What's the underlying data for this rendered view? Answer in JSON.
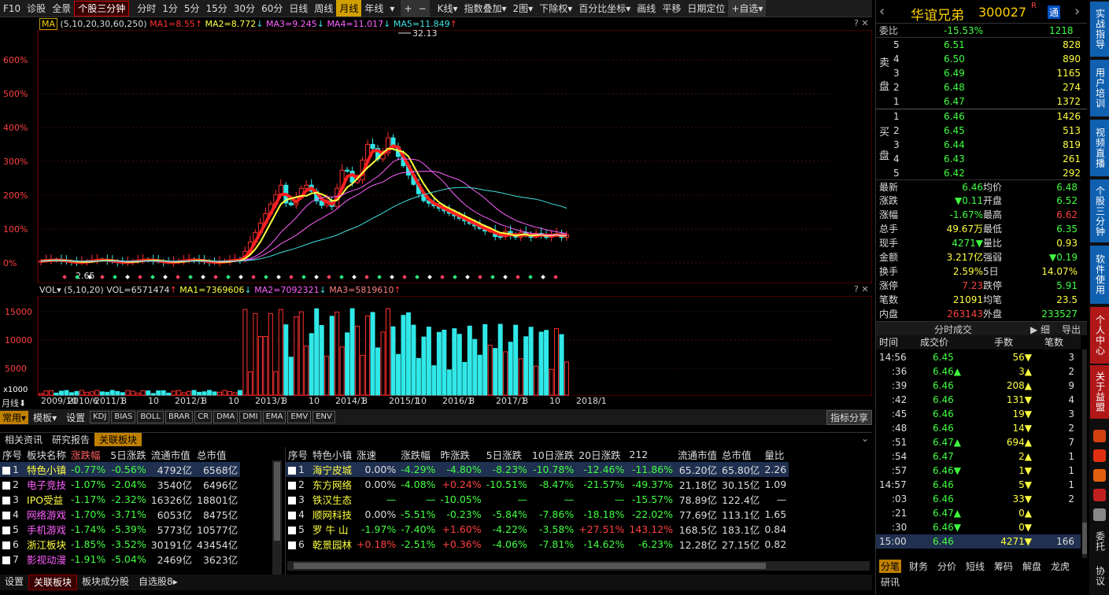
{
  "toolbar": {
    "f10": "F10",
    "diag": "诊股",
    "full": "全景",
    "intraday3": "个股三分钟",
    "periods": [
      "分时",
      "1分",
      "5分",
      "15分",
      "30分",
      "60分",
      "日线",
      "周线",
      "月线",
      "年线"
    ],
    "active_period": "月线",
    "plus": "+",
    "minus": "−",
    "kline": "K线",
    "index_overlay": "指数叠加",
    "two_chart": "2图",
    "adjust": "下除权",
    "percent_axis": "百分比坐标",
    "draw": "画线",
    "pan": "平移",
    "date_locate": "日期定位",
    "fav": "+自选"
  },
  "ma_legend": {
    "name": "MA",
    "params": "(5,10,20,30,60,250)",
    "ma1": "MA1=8.55",
    "ma2": "MA2=8.772",
    "ma3": "MA3=9.245",
    "ma4": "MA4=11.017",
    "ma5": "MA5=11.849",
    "high_label": "32.13",
    "low_label": "2.65"
  },
  "yaxis": [
    "600%",
    "500%",
    "400%",
    "300%",
    "200%",
    "100%",
    "0%"
  ],
  "vol_legend": {
    "name": "VOL",
    "params": "(5,10,20)",
    "vol": "VOL=6571474",
    "ma1": "MA1=7369606",
    "ma2": "MA2=7092321",
    "ma3": "MA3=5819610",
    "x1000": "x1000"
  },
  "vol_yaxis": [
    "15000",
    "10000",
    "5000"
  ],
  "xaxis": [
    "2009/10",
    "2010/6",
    "2011/1",
    "8",
    "10",
    "2012/1",
    "8",
    "10",
    "2013/1",
    "8",
    "10",
    "2014/1",
    "8",
    "2015/1",
    "10",
    "2016/1",
    "8",
    "2017/1",
    "8",
    "10",
    "2018/1"
  ],
  "bottom_bar": {
    "period": "月线",
    "common": "常用",
    "template": "模板",
    "settings": "设置",
    "indicators": [
      "KDJ",
      "BIAS",
      "BOLL",
      "BRAR",
      "CR",
      "DMA",
      "DMI",
      "EMA",
      "EMV",
      "ENV"
    ],
    "share": "指标分享"
  },
  "info_tabs": [
    "相关资讯",
    "研究报告",
    "关联板块"
  ],
  "sector_table": {
    "headers": [
      "序号",
      "板块名称",
      "涨跌幅",
      "5日涨跌",
      "流通市值",
      "总市值"
    ],
    "rows": [
      [
        "1",
        "特色小镇",
        "-0.77%",
        "-0.56%",
        "4792亿",
        "6568亿"
      ],
      [
        "2",
        "电子竞技",
        "-1.07%",
        "-2.04%",
        "3540亿",
        "6496亿"
      ],
      [
        "3",
        "IPO受益",
        "-1.17%",
        "-2.32%",
        "16326亿",
        "18801亿"
      ],
      [
        "4",
        "网络游戏",
        "-1.70%",
        "-3.71%",
        "6053亿",
        "8475亿"
      ],
      [
        "5",
        "手机游戏",
        "-1.74%",
        "-5.39%",
        "5773亿",
        "10577亿"
      ],
      [
        "6",
        "浙江板块",
        "-1.85%",
        "-3.52%",
        "30191亿",
        "43454亿"
      ],
      [
        "7",
        "影视动漫",
        "-1.91%",
        "-5.04%",
        "2469亿",
        "3623亿"
      ]
    ]
  },
  "stock_table": {
    "headers": [
      "序号",
      "特色小镇",
      "涨速",
      "涨跌幅",
      "昨涨跌",
      "5日涨跌",
      "10日涨跌",
      "20日涨跌",
      "212",
      "流通市值",
      "总市值",
      "量比"
    ],
    "rows": [
      [
        "1",
        "海宁皮城",
        "0.00%",
        "-4.29%",
        "-4.80%",
        "-8.23%",
        "-10.78%",
        "-12.46%",
        "-11.86%",
        "65.20亿",
        "65.80亿",
        "2.26"
      ],
      [
        "2",
        "东方网络",
        "0.00%",
        "-4.08%",
        "+0.24%",
        "-10.51%",
        "-8.47%",
        "-21.57%",
        "-49.37%",
        "21.18亿",
        "30.15亿",
        "1.09"
      ],
      [
        "3",
        "铁汉生态",
        "—",
        "—",
        "-10.05%",
        "—",
        "—",
        "—",
        "-15.57%",
        "78.89亿",
        "122.4亿",
        "—"
      ],
      [
        "4",
        "顺网科技",
        "0.00%",
        "-5.51%",
        "-0.23%",
        "-5.84%",
        "-7.86%",
        "-18.18%",
        "-22.02%",
        "77.69亿",
        "113.1亿",
        "1.65"
      ],
      [
        "5",
        "罗 牛 山",
        "-1.97%",
        "-7.40%",
        "+1.60%",
        "-4.22%",
        "-3.58%",
        "+27.51%",
        "143.12%",
        "168.5亿",
        "183.1亿",
        "0.84"
      ],
      [
        "6",
        "乾景园林",
        "+0.18%",
        "-2.51%",
        "+0.36%",
        "-4.06%",
        "-7.81%",
        "-14.62%",
        "-6.23%",
        "12.28亿",
        "27.15亿",
        "0.82"
      ]
    ]
  },
  "bottom_tabs": [
    "设置",
    "关联板块",
    "板块成分股",
    "自选股8"
  ],
  "stock": {
    "name": "华谊兄弟",
    "code": "300027",
    "flag": "R",
    "tong": "通",
    "wei_label": "委比",
    "wei_bi": "-15.53%",
    "wei_cha": "1218",
    "sell_label": "卖盘",
    "buy_label": "买盘",
    "sell": [
      [
        "5",
        "6.51",
        "828"
      ],
      [
        "4",
        "6.50",
        "890"
      ],
      [
        "3",
        "6.49",
        "1165"
      ],
      [
        "2",
        "6.48",
        "274"
      ],
      [
        "1",
        "6.47",
        "1372"
      ]
    ],
    "buy": [
      [
        "1",
        "6.46",
        "1426"
      ],
      [
        "2",
        "6.45",
        "513"
      ],
      [
        "3",
        "6.44",
        "819"
      ],
      [
        "4",
        "6.43",
        "261"
      ],
      [
        "5",
        "6.42",
        "292"
      ]
    ],
    "quote": [
      [
        "最新",
        "6.46",
        "均价",
        "6.48"
      ],
      [
        "涨跌",
        "▼0.11",
        "开盘",
        "6.52"
      ],
      [
        "涨幅",
        "-1.67%",
        "最高",
        "6.62"
      ],
      [
        "总手",
        "49.67万",
        "最低",
        "6.35"
      ],
      [
        "现手",
        "4271▼",
        "量比",
        "0.93"
      ],
      [
        "金额",
        "3.217亿",
        "强弱",
        "▼0.19"
      ],
      [
        "换手",
        "2.59%",
        "5日",
        "14.07%"
      ],
      [
        "涨停",
        "7.23",
        "跌停",
        "5.91"
      ],
      [
        "笔数",
        "21091",
        "均笔",
        "23.5"
      ],
      [
        "内盘",
        "263143",
        "外盘",
        "233527"
      ]
    ],
    "tick_title": "分时成交",
    "tick_detail": "细",
    "tick_export": "导出",
    "tick_headers": [
      "时间",
      "成交价",
      "手数",
      "笔数"
    ],
    "ticks": [
      [
        "14:56",
        "6.45",
        "56▼",
        "3"
      ],
      [
        ":36",
        "6.46▲",
        "3▲",
        "2"
      ],
      [
        ":39",
        "6.46",
        "208▲",
        "9"
      ],
      [
        ":42",
        "6.46",
        "131▼",
        "4"
      ],
      [
        ":45",
        "6.46",
        "19▼",
        "3"
      ],
      [
        ":48",
        "6.46",
        "14▼",
        "2"
      ],
      [
        ":51",
        "6.47▲",
        "694▲",
        "7"
      ],
      [
        ":54",
        "6.47",
        "2▲",
        "1"
      ],
      [
        ":57",
        "6.46▼",
        "1▼",
        "1"
      ],
      [
        "14:57",
        "6.46",
        "5▼",
        "1"
      ],
      [
        ":03",
        "6.46",
        "33▼",
        "2"
      ],
      [
        ":21",
        "6.47▲",
        "0▲",
        ""
      ],
      [
        ":30",
        "6.46▼",
        "0▼",
        ""
      ],
      [
        "15:00",
        "6.46",
        "4271▼",
        "166"
      ]
    ],
    "tabs": [
      "分笔",
      "财务",
      "分价",
      "短线",
      "筹码",
      "解盘",
      "龙虎",
      "研讯"
    ]
  },
  "sidebar": [
    "实战指导",
    "用户培训",
    "视频直播",
    "个股三分钟",
    "软件使用",
    "个人中心",
    "关于益盟",
    "委托",
    "协议"
  ],
  "colors": {
    "up": "#ff3030",
    "down": "#30e8e8",
    "ma1": "#ffffff",
    "ma2": "#ffff00",
    "ma3": "#ff00ff",
    "ma4": "#00ff00",
    "ma5": "#40e0e0"
  }
}
